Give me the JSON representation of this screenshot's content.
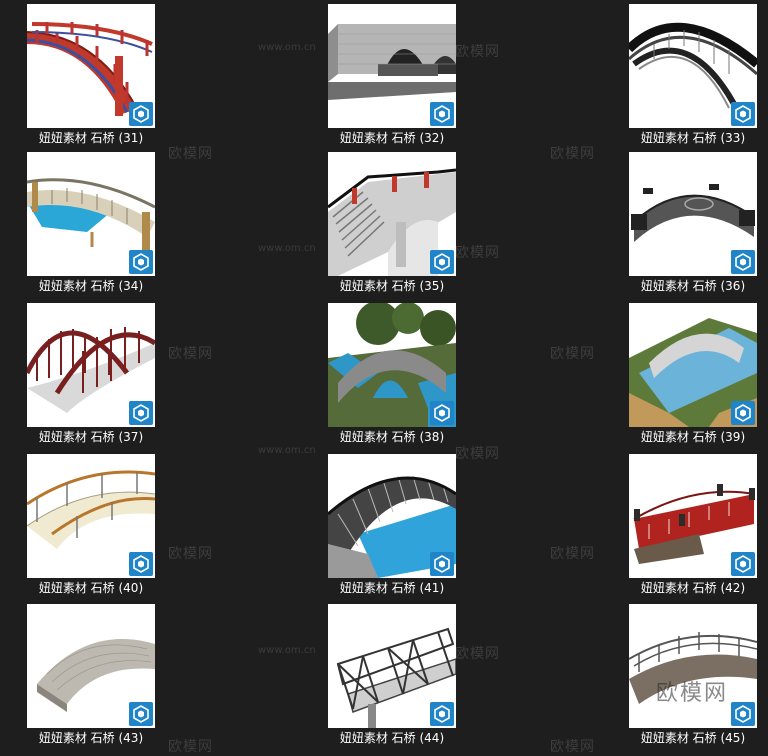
{
  "watermark": {
    "url": "www.om.cn",
    "brand": "欧模网"
  },
  "tiles": [
    {
      "caption": "妞妞素材 石桥 (31)",
      "icon": "sketchup-icon"
    },
    {
      "caption": "妞妞素材 石桥 (32)",
      "icon": "sketchup-icon"
    },
    {
      "caption": "妞妞素材 石桥 (33)",
      "icon": "sketchup-icon"
    },
    {
      "caption": "妞妞素材 石桥 (34)",
      "icon": "sketchup-icon"
    },
    {
      "caption": "妞妞素材 石桥 (35)",
      "icon": "sketchup-icon"
    },
    {
      "caption": "妞妞素材 石桥 (36)",
      "icon": "sketchup-icon"
    },
    {
      "caption": "妞妞素材 石桥 (37)",
      "icon": "sketchup-icon"
    },
    {
      "caption": "妞妞素材 石桥 (38)",
      "icon": "sketchup-icon"
    },
    {
      "caption": "妞妞素材 石桥 (39)",
      "icon": "sketchup-icon"
    },
    {
      "caption": "妞妞素材 石桥 (40)",
      "icon": "sketchup-icon"
    },
    {
      "caption": "妞妞素材 石桥 (41)",
      "icon": "sketchup-icon"
    },
    {
      "caption": "妞妞素材 石桥 (42)",
      "icon": "sketchup-icon"
    },
    {
      "caption": "妞妞素材 石桥 (43)",
      "icon": "sketchup-icon"
    },
    {
      "caption": "妞妞素材 石桥 (44)",
      "icon": "sketchup-icon"
    },
    {
      "caption": "妞妞素材 石桥 (45)",
      "icon": "sketchup-icon"
    }
  ],
  "colors": {
    "background": "#1e1e1e",
    "badge": "#1f84c8",
    "caption": "#ffffff"
  }
}
